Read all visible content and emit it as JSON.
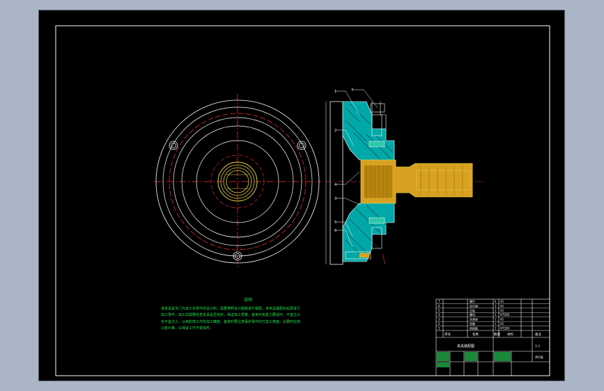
{
  "notes": {
    "title": "说明",
    "lines": [
      "该夹具是专门为加工本零件而设计的，需要按照设计图纸进行装配，待夹具装配好后再进行",
      "加工零件，加工前需要检查夹具是否完好，保证加工质量，装夹时夹紧力要适中，不宜过大",
      "也不宜过小，以免影响工件的加工精度，装夹时要注意保护零件的已加工表面，必要时应加",
      "以垫片等，以保证工件不受损伤。"
    ]
  },
  "balloons": [
    "1",
    "7",
    "2",
    "4",
    "3",
    "5",
    "6"
  ],
  "title_block": {
    "columns": [
      "序号",
      "名称",
      "数量",
      "材料",
      "备注"
    ],
    "rows": [
      [
        "7",
        "螺钉",
        "4",
        "45",
        ""
      ],
      [
        "6",
        "定位销",
        "1",
        "45",
        ""
      ],
      [
        "5",
        "压板",
        "1",
        "45",
        ""
      ],
      [
        "4",
        "螺母",
        "1",
        "HT200",
        ""
      ],
      [
        "3",
        "夹具体",
        "1",
        "45",
        ""
      ],
      [
        "2",
        "垫圈",
        "1",
        "45",
        ""
      ],
      [
        "1",
        "转接盘",
        "1",
        "HT200",
        ""
      ]
    ],
    "drawing_title": "夹具装配图",
    "scale": "1:1",
    "sheet": "共1张"
  },
  "colors": {
    "sheet": "#000000",
    "outline": "#ffffff",
    "centerline": "#ff3333",
    "part_fill": "#00a8a8",
    "bushing": "#e8d040",
    "notes": "#22e04c"
  }
}
